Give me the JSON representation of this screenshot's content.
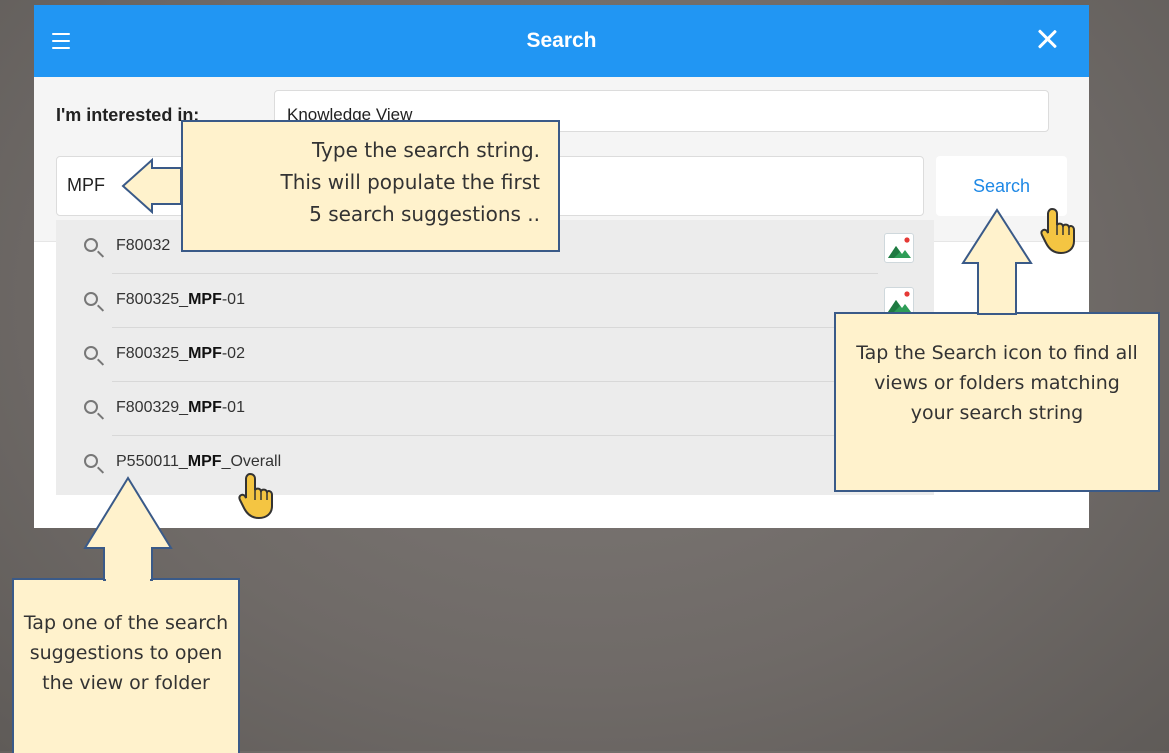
{
  "titlebar": {
    "title": "Search"
  },
  "panel": {
    "interest_label": "I'm interested in:",
    "interest_value": "Knowledge View",
    "search_value": "MPF",
    "search_button": "Search"
  },
  "suggestions": [
    {
      "prefix": "F80032",
      "match": "",
      "suffix": ""
    },
    {
      "prefix": "F800325_",
      "match": "MPF",
      "suffix": "-01"
    },
    {
      "prefix": "F800325_",
      "match": "MPF",
      "suffix": "-02"
    },
    {
      "prefix": "F800329_",
      "match": "MPF",
      "suffix": "-01"
    },
    {
      "prefix": "P550011_",
      "match": "MPF",
      "suffix": "_Overall"
    }
  ],
  "callouts": {
    "type_line1": "Type the search string.",
    "type_line2": "This will populate the first",
    "type_line3": "5 search suggestions ..",
    "tapsearch": "Tap the Search icon to find all views or folders matching your search string",
    "suggest": "Tap one of the search suggestions to open the view or folder"
  },
  "colors": {
    "titlebar": "#2196f3",
    "callout_fill": "#fff2cc",
    "callout_border": "#3a5a88",
    "link_blue": "#1e88e5"
  },
  "icons": {
    "menu": "menu-icon",
    "close": "close-icon",
    "search_row": "search-icon",
    "image": "image-icon",
    "hand": "hand-pointer-icon"
  }
}
